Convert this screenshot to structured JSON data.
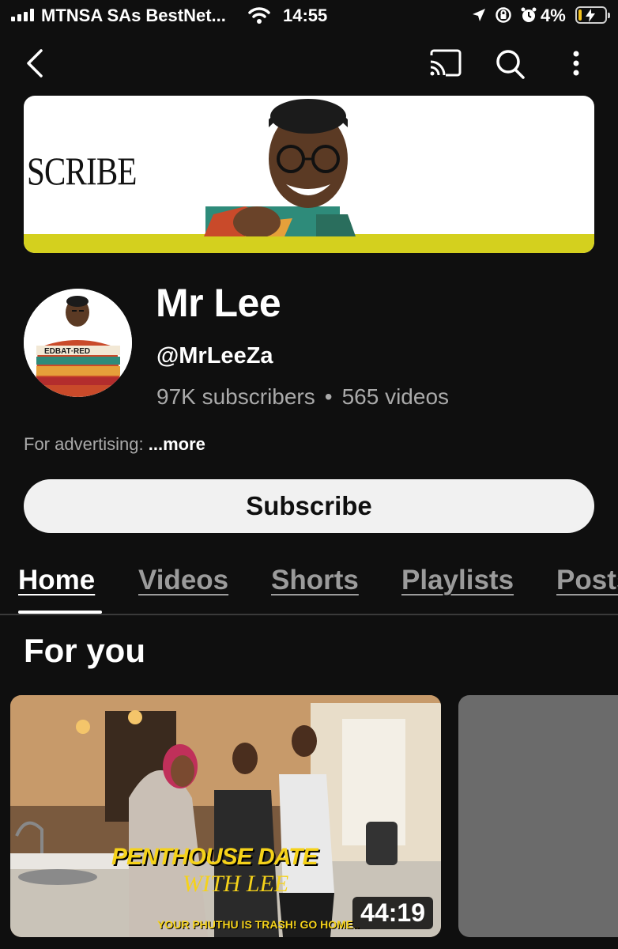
{
  "status_bar": {
    "carrier": "MTNSA SAs BestNet...",
    "time": "14:55",
    "battery": "4%",
    "battery_color": "#f4c21b"
  },
  "top_nav": {
    "icons": [
      "back-icon",
      "cast-icon",
      "search-icon",
      "more-vert-icon"
    ]
  },
  "banner": {
    "text": "SCRIBE",
    "accent_color": "#d4d01e"
  },
  "channel": {
    "name": "Mr Lee",
    "handle": "@MrLeeZa",
    "subscribers": "97K subscribers",
    "separator": "•",
    "videos": "565 videos",
    "description": "For advertising:",
    "more": " ...more"
  },
  "subscribe": {
    "label": "Subscribe"
  },
  "tabs": [
    {
      "label": "Home",
      "active": true
    },
    {
      "label": "Videos",
      "active": false
    },
    {
      "label": "Shorts",
      "active": false
    },
    {
      "label": "Playlists",
      "active": false
    },
    {
      "label": "Posts",
      "active": false
    }
  ],
  "section": {
    "title": "For you"
  },
  "videos": [
    {
      "thumb_title": "PENTHOUSE DATE",
      "thumb_subtitle": "WITH LEE",
      "thumb_caption": "YOUR PHUTHU IS TRASH! GO HOME..",
      "duration": "44:19"
    }
  ]
}
